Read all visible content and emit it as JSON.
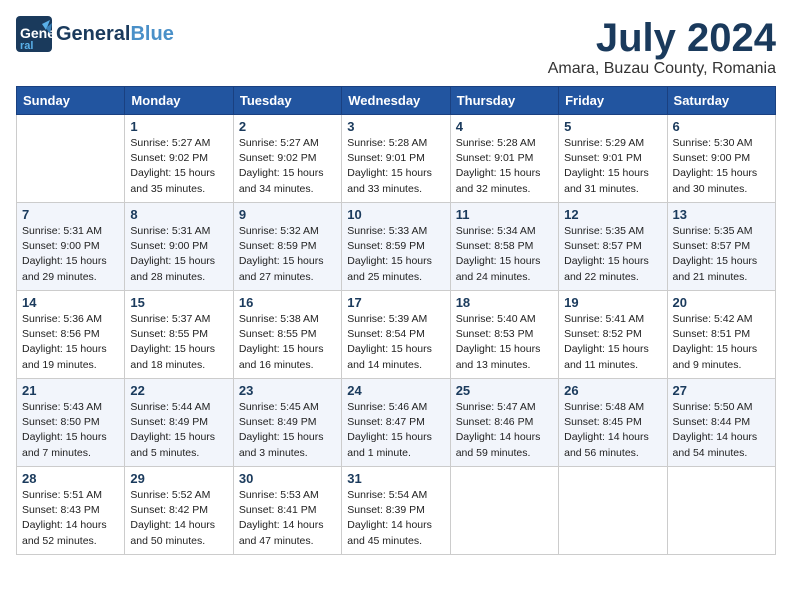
{
  "app": {
    "logo_main": "General",
    "logo_accent": "Blue",
    "month_title": "July 2024",
    "location": "Amara, Buzau County, Romania"
  },
  "calendar": {
    "headers": [
      "Sunday",
      "Monday",
      "Tuesday",
      "Wednesday",
      "Thursday",
      "Friday",
      "Saturday"
    ],
    "weeks": [
      [
        {
          "day": "",
          "info": ""
        },
        {
          "day": "1",
          "info": "Sunrise: 5:27 AM\nSunset: 9:02 PM\nDaylight: 15 hours\nand 35 minutes."
        },
        {
          "day": "2",
          "info": "Sunrise: 5:27 AM\nSunset: 9:02 PM\nDaylight: 15 hours\nand 34 minutes."
        },
        {
          "day": "3",
          "info": "Sunrise: 5:28 AM\nSunset: 9:01 PM\nDaylight: 15 hours\nand 33 minutes."
        },
        {
          "day": "4",
          "info": "Sunrise: 5:28 AM\nSunset: 9:01 PM\nDaylight: 15 hours\nand 32 minutes."
        },
        {
          "day": "5",
          "info": "Sunrise: 5:29 AM\nSunset: 9:01 PM\nDaylight: 15 hours\nand 31 minutes."
        },
        {
          "day": "6",
          "info": "Sunrise: 5:30 AM\nSunset: 9:00 PM\nDaylight: 15 hours\nand 30 minutes."
        }
      ],
      [
        {
          "day": "7",
          "info": "Sunrise: 5:31 AM\nSunset: 9:00 PM\nDaylight: 15 hours\nand 29 minutes."
        },
        {
          "day": "8",
          "info": "Sunrise: 5:31 AM\nSunset: 9:00 PM\nDaylight: 15 hours\nand 28 minutes."
        },
        {
          "day": "9",
          "info": "Sunrise: 5:32 AM\nSunset: 8:59 PM\nDaylight: 15 hours\nand 27 minutes."
        },
        {
          "day": "10",
          "info": "Sunrise: 5:33 AM\nSunset: 8:59 PM\nDaylight: 15 hours\nand 25 minutes."
        },
        {
          "day": "11",
          "info": "Sunrise: 5:34 AM\nSunset: 8:58 PM\nDaylight: 15 hours\nand 24 minutes."
        },
        {
          "day": "12",
          "info": "Sunrise: 5:35 AM\nSunset: 8:57 PM\nDaylight: 15 hours\nand 22 minutes."
        },
        {
          "day": "13",
          "info": "Sunrise: 5:35 AM\nSunset: 8:57 PM\nDaylight: 15 hours\nand 21 minutes."
        }
      ],
      [
        {
          "day": "14",
          "info": "Sunrise: 5:36 AM\nSunset: 8:56 PM\nDaylight: 15 hours\nand 19 minutes."
        },
        {
          "day": "15",
          "info": "Sunrise: 5:37 AM\nSunset: 8:55 PM\nDaylight: 15 hours\nand 18 minutes."
        },
        {
          "day": "16",
          "info": "Sunrise: 5:38 AM\nSunset: 8:55 PM\nDaylight: 15 hours\nand 16 minutes."
        },
        {
          "day": "17",
          "info": "Sunrise: 5:39 AM\nSunset: 8:54 PM\nDaylight: 15 hours\nand 14 minutes."
        },
        {
          "day": "18",
          "info": "Sunrise: 5:40 AM\nSunset: 8:53 PM\nDaylight: 15 hours\nand 13 minutes."
        },
        {
          "day": "19",
          "info": "Sunrise: 5:41 AM\nSunset: 8:52 PM\nDaylight: 15 hours\nand 11 minutes."
        },
        {
          "day": "20",
          "info": "Sunrise: 5:42 AM\nSunset: 8:51 PM\nDaylight: 15 hours\nand 9 minutes."
        }
      ],
      [
        {
          "day": "21",
          "info": "Sunrise: 5:43 AM\nSunset: 8:50 PM\nDaylight: 15 hours\nand 7 minutes."
        },
        {
          "day": "22",
          "info": "Sunrise: 5:44 AM\nSunset: 8:49 PM\nDaylight: 15 hours\nand 5 minutes."
        },
        {
          "day": "23",
          "info": "Sunrise: 5:45 AM\nSunset: 8:49 PM\nDaylight: 15 hours\nand 3 minutes."
        },
        {
          "day": "24",
          "info": "Sunrise: 5:46 AM\nSunset: 8:47 PM\nDaylight: 15 hours\nand 1 minute."
        },
        {
          "day": "25",
          "info": "Sunrise: 5:47 AM\nSunset: 8:46 PM\nDaylight: 14 hours\nand 59 minutes."
        },
        {
          "day": "26",
          "info": "Sunrise: 5:48 AM\nSunset: 8:45 PM\nDaylight: 14 hours\nand 56 minutes."
        },
        {
          "day": "27",
          "info": "Sunrise: 5:50 AM\nSunset: 8:44 PM\nDaylight: 14 hours\nand 54 minutes."
        }
      ],
      [
        {
          "day": "28",
          "info": "Sunrise: 5:51 AM\nSunset: 8:43 PM\nDaylight: 14 hours\nand 52 minutes."
        },
        {
          "day": "29",
          "info": "Sunrise: 5:52 AM\nSunset: 8:42 PM\nDaylight: 14 hours\nand 50 minutes."
        },
        {
          "day": "30",
          "info": "Sunrise: 5:53 AM\nSunset: 8:41 PM\nDaylight: 14 hours\nand 47 minutes."
        },
        {
          "day": "31",
          "info": "Sunrise: 5:54 AM\nSunset: 8:39 PM\nDaylight: 14 hours\nand 45 minutes."
        },
        {
          "day": "",
          "info": ""
        },
        {
          "day": "",
          "info": ""
        },
        {
          "day": "",
          "info": ""
        }
      ]
    ]
  }
}
